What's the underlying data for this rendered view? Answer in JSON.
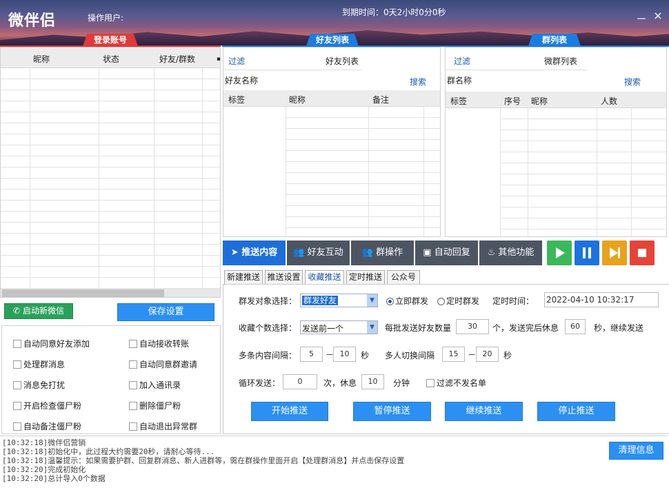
{
  "titlebar": {
    "app_name": "微伴侣",
    "operator_label": "操作用户:",
    "expire": "到期时间：0天2小时0分0秒",
    "minimize": "－",
    "close": "×"
  },
  "sections": {
    "login": "登录账号",
    "friends": "好友列表",
    "groups": "群列表"
  },
  "accounts": {
    "columns": [
      "昵称",
      "状态",
      "好友/群数",
      "￭"
    ]
  },
  "friends": {
    "filter": "过滤",
    "list_title": "好友列表",
    "name_label": "好友名称",
    "search": "搜索",
    "columns": [
      "标签",
      "昵称",
      "备注"
    ]
  },
  "groups": {
    "filter": "过滤",
    "list_title": "微群列表",
    "name_label": "群名称",
    "search": "搜索",
    "columns": [
      "标签",
      "序号",
      "昵称",
      "人数"
    ]
  },
  "left_buttons": {
    "new_wechat": "启动新微信",
    "save": "保存设置"
  },
  "options": [
    {
      "label": "自动同意好友添加",
      "checked": false
    },
    {
      "label": "自动接收转账",
      "checked": false
    },
    {
      "label": "处理群消息",
      "checked": false
    },
    {
      "label": "自动同意群邀请",
      "checked": false
    },
    {
      "label": "消息免打扰",
      "checked": false
    },
    {
      "label": "加入通讯录",
      "checked": false
    },
    {
      "label": "开启检查僵尸粉",
      "checked": false
    },
    {
      "label": "删除僵尸粉",
      "checked": false
    },
    {
      "label": "自动备注僵尸粉",
      "checked": false
    },
    {
      "label": "自动退出异常群",
      "checked": false
    }
  ],
  "toolbar": {
    "push": "推送内容",
    "friend": "好友互动",
    "group": "群操作",
    "reply": "自动回复",
    "other": "其他功能"
  },
  "subtabs": [
    "新建推送",
    "推送设置",
    "收藏推送",
    "定时推送",
    "公众号"
  ],
  "form": {
    "target_label": "群发对象选择：",
    "target_value": "群发好友",
    "now_label": "立即群发",
    "timed_label": "定时群发",
    "time_label": "定时时间：",
    "time_value": "2022-04-10 10:32:17",
    "count_label": "收藏个数选择：",
    "count_value": "发送前一个",
    "batch_label": "每批发送好友数量",
    "batch_value": "30",
    "rest_label": "个，发送完后休息",
    "rest_value": "60",
    "rest_unit": "秒，继续发送",
    "interval_label": "多条内容间隔：",
    "interval_from": "5",
    "dash": "－",
    "interval_to": "10",
    "sec": "秒",
    "switch_label": "多人切换间隔",
    "switch_from": "15",
    "switch_to": "20",
    "loop_label": "循环发送：",
    "loop_value": "0",
    "loop_unit": "次，休息",
    "loop_rest": "10",
    "minute": "分钟",
    "filter_label": "过滤不发名单",
    "start": "开始推送",
    "pause": "暂停推送",
    "resume": "继续推送",
    "stop": "停止推送"
  },
  "log": {
    "clear": "清理信息",
    "lines": [
      "[10:32:18]微伴侣营销",
      "[10:32:18]初始化中，此过程大约需要20秒，请耐心等待...",
      "[10:32:18]温馨提示：如果需要护群、回复群消息、新人进群等，需在群操作里面开启【处理群消息】并点击保存设置",
      "[10:32:20]完成初始化",
      "[10:32:20]总计导入0个数据"
    ]
  },
  "colors": {
    "accent": "#1d6ed8",
    "play": "#3bb85a",
    "pause": "#1e72e0",
    "skip": "#e8a21c",
    "stop": "#e5443a",
    "wechat": "#2aa15a"
  }
}
